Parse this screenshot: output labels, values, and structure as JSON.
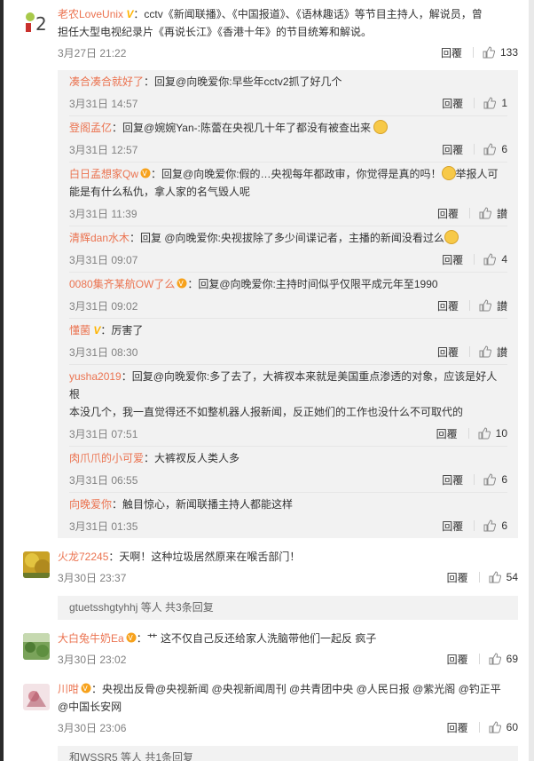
{
  "top": {
    "name": "老农LoveUnix",
    "verified_mark": "V",
    "text": "：cctv《新闻联播》、《中国报道》、《语林趣话》等节目主持人，解说员，曾担任大型电视纪录片《再说长江》《香港十年》的节目统筹和解说。",
    "text_line1": "：cctv《新闻联播》、《中国报道》、《语林趣话》等节目主持人，解说员，曾",
    "text_line2": "担任大型电视纪录片《再说长江》《香港十年》的节目统筹和解说。",
    "time": "3月27日 21:22",
    "reply": "回覆",
    "likes": "133"
  },
  "replies": [
    {
      "name": "凑合凑合就好了",
      "body": "：回复@向晚爱你:早些年cctv2抓了好几个",
      "time": "3月31日 14:57",
      "reply": "回覆",
      "likes": "1",
      "badge": false,
      "emoji": false
    },
    {
      "name": "登阁孟亿",
      "body": "：回复@婉婉Yan-:陈蕾在央视几十年了都没有被查出来",
      "time": "3月31日 12:57",
      "reply": "回覆",
      "likes": "6",
      "badge": false,
      "emoji": true
    },
    {
      "name": "白日孟想家Qw",
      "body_line1": "：回复@向晚爱你:假的…央视每年都政审，你觉得是真的吗！",
      "body_line1b": "举报人可",
      "body_line2": "能是有什么私仇，拿人家的名气毁人呢",
      "time": "3月31日 11:39",
      "reply": "回覆",
      "likes": "讃",
      "badge": true,
      "emoji": true
    },
    {
      "name": "清辉dan水木",
      "body": "：回复 @向晚爱你:央视拔除了多少间谍记者，主播的新闻没看过么",
      "time": "3月31日 09:07",
      "reply": "回覆",
      "likes": "4",
      "badge": false,
      "emoji": true
    },
    {
      "name": "0080集齐某航OW了么",
      "body": "：回复@向晚爱你:主持时间似乎仅限平成元年至1990",
      "time": "3月31日 09:02",
      "reply": "回覆",
      "likes": "讃",
      "badge": true,
      "emoji": false
    },
    {
      "name": "懂菌",
      "verified_mark": "V",
      "body": "：厉害了",
      "time": "3月31日 08:30",
      "reply": "回覆",
      "likes": "讃",
      "badge": false,
      "emoji": false
    },
    {
      "name": "yusha2019",
      "body_line1": "：回复@向晚爱你:多了去了，大裤衩本来就是美国重点渗透的对象，应该是好人根",
      "body_line2": "本没几个，我一直觉得还不如整机器人报新闻，反正她们的工作也没什么不可取代的",
      "time": "3月31日 07:51",
      "reply": "回覆",
      "likes": "10",
      "badge": false,
      "emoji": false
    },
    {
      "name": "肉爪爪的小可爱",
      "body": "：大裤衩反人类人多",
      "time": "3月31日 06:55",
      "reply": "回覆",
      "likes": "6",
      "badge": false,
      "emoji": false
    },
    {
      "name": "向晚爱你",
      "body": "：触目惊心，新闻联播主持人都能这样",
      "time": "3月31日 01:35",
      "reply": "回覆",
      "likes": "6",
      "badge": false,
      "emoji": false
    }
  ],
  "comments": [
    {
      "name": "火龙72245",
      "body": "：天啊！这种垃圾居然原来在喉舌部门！",
      "time": "3月30日 23:37",
      "reply": "回覆",
      "likes": "54",
      "more": "gtuetsshgtyhhj 等人 共3条回复"
    },
    {
      "name": "大白兔牛奶Ea",
      "body": "：艹 这不仅自己反还给家人洗脑带他们一起反 疯子",
      "time": "3月30日 23:02",
      "reply": "回覆",
      "likes": "69"
    },
    {
      "name": "川咁",
      "body_line1": "：央视出反骨@央视新闻 @央视新闻周刊 @共青团中央 @人民日报 @紫光阁 @钓正平",
      "body_line2": "@中国长安网",
      "time": "3月30日 23:06",
      "reply": "回覆",
      "likes": "60",
      "more": "和WSSR5 等人 共1条回复"
    }
  ],
  "colors": {
    "username": "#eb7350",
    "verified": "#ffb400",
    "reply_bg": "#f2f2f2"
  },
  "icons": [
    "thumb-up-icon",
    "verified-v-icon",
    "vip-badge-icon",
    "emoji-icon"
  ]
}
